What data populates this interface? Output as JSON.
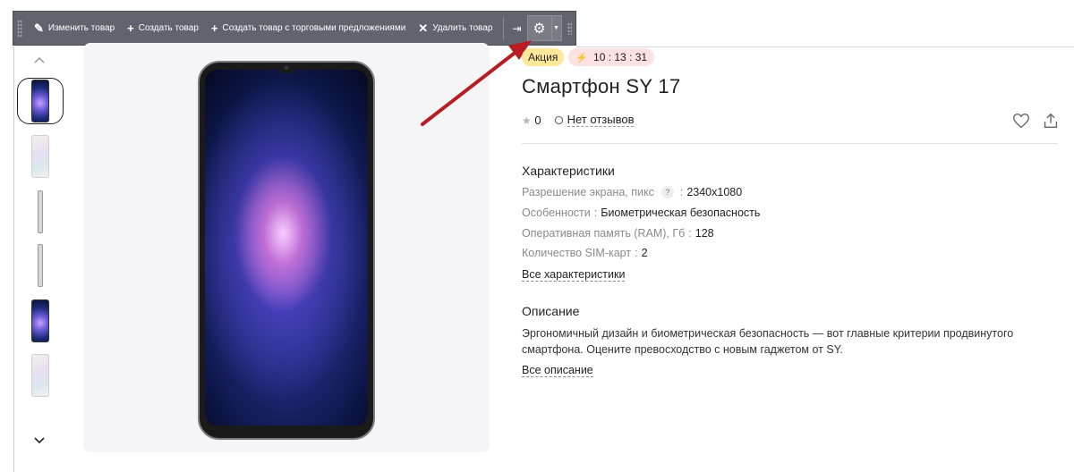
{
  "toolbar": {
    "edit_label": "Изменить товар",
    "create_label": "Создать товар",
    "create_offers_label": "Создать товар с торговыми предложениями",
    "delete_label": "Удалить товар",
    "pin_icon": "pin-icon",
    "settings_icon": "gear-icon"
  },
  "gallery": {
    "thumbnails": [
      "front-dark",
      "back-light",
      "side",
      "side",
      "front-dark",
      "back-light"
    ],
    "selected_index": 0
  },
  "product": {
    "badge_sale": "Акция",
    "timer": "10 : 13 : 31",
    "title": "Смартфон SY 17",
    "rating": "0",
    "reviews_label": "Нет отзывов"
  },
  "specs": {
    "title": "Характеристики",
    "items": [
      {
        "key": "Разрешение экрана, пикс",
        "value": "2340x1080",
        "hint": "?"
      },
      {
        "key": "Особенности",
        "value": "Биометрическая безопасность"
      },
      {
        "key": "Оперативная память (RAM), Гб",
        "value": "128"
      },
      {
        "key": "Количество SIM-карт",
        "value": "2"
      }
    ],
    "all_label": "Все характеристики"
  },
  "description": {
    "title": "Описание",
    "text": "Эргономичный дизайн и биометрическая безопасность — вот главные критерии продвинутого смартфона. Оцените превосходство с новым гаджетом от SY.",
    "all_label": "Все описание"
  },
  "colors": {
    "toolbar_bg": "#62646d",
    "arrow": "#b81d22",
    "sale_badge": "#ffe89a",
    "timer_badge": "#fde1e3"
  }
}
